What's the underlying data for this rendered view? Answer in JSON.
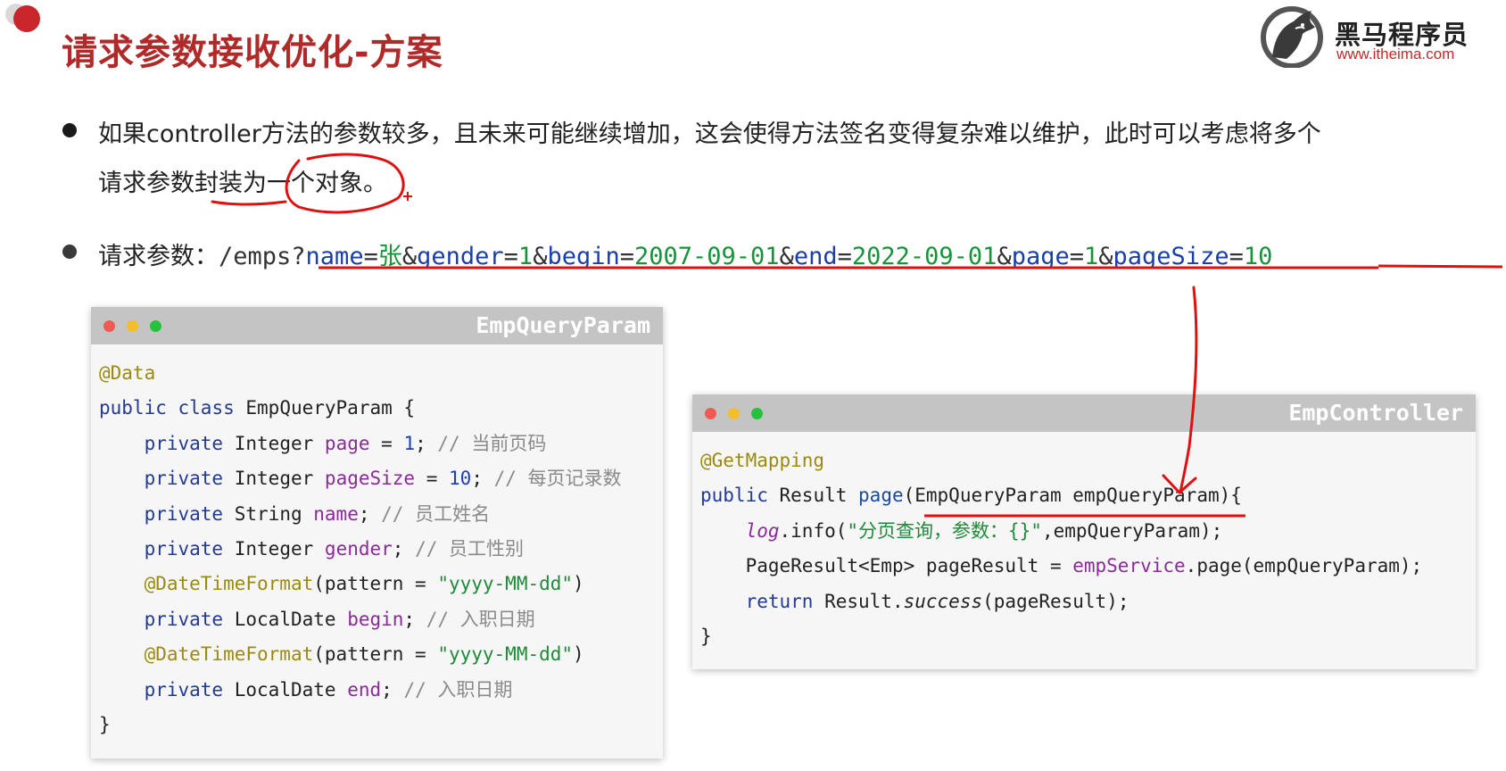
{
  "slide": {
    "title": "请求参数接收优化-方案",
    "logo": {
      "name": "黑马程序员",
      "url": "www.itheima.com"
    }
  },
  "bullets": {
    "first": {
      "line1": "如果controller方法的参数较多，且未来可能继续增加，这会使得方法签名变得复杂难以维护，此时可以考虑将多个",
      "line2": "请求参数封装为一个对象。"
    },
    "second": {
      "label": "请求参数：",
      "path": "/emps?",
      "params": [
        {
          "key": "name",
          "value": "张"
        },
        {
          "key": "gender",
          "value": "1"
        },
        {
          "key": "begin",
          "value": "2007-09-01"
        },
        {
          "key": "end",
          "value": "2022-09-01"
        },
        {
          "key": "page",
          "value": "1"
        },
        {
          "key": "pageSize",
          "value": "10"
        }
      ],
      "eq": "=",
      "amp": "&"
    }
  },
  "param_window": {
    "title": "EmpQueryParam",
    "code": {
      "l1_ann": "@Data",
      "l2_public": "public",
      "l2_class": "class",
      "l2_rest": "EmpQueryParam {",
      "private": "private",
      "l3_type": "Integer",
      "l3_field": "page",
      "l3_eq": " = ",
      "l3_num": "1",
      "l3_semi": ";",
      "l3_cmt": "// 当前页码",
      "l4_type": "Integer",
      "l4_field": "pageSize",
      "l4_eq": " = ",
      "l4_num": "10",
      "l4_semi": ";",
      "l4_cmt": "// 每页记录数",
      "l5_type": "String",
      "l5_field": "name",
      "l5_semi": ";",
      "l5_cmt": "// 员工姓名",
      "l6_type": "Integer",
      "l6_field": "gender",
      "l6_semi": ";",
      "l6_cmt": "// 员工性别",
      "l7_ann": "@DateTimeFormat",
      "l7_mid": "(pattern = ",
      "l7_str": "\"yyyy-MM-dd\"",
      "l7_end": ")",
      "l8_type": "LocalDate",
      "l8_field": "begin",
      "l8_semi": ";",
      "l8_cmt": "// 入职日期",
      "l9_ann": "@DateTimeFormat",
      "l9_mid": "(pattern = ",
      "l9_str": "\"yyyy-MM-dd\"",
      "l9_end": ")",
      "l10_type": "LocalDate",
      "l10_field": "end",
      "l10_semi": ";",
      "l10_cmt": "// 入职日期",
      "close": "}"
    }
  },
  "controller_window": {
    "title": "EmpController",
    "code": {
      "l1_ann": "@GetMapping",
      "l2_public": "public",
      "l2_type": "Result",
      "l2_meth": "page",
      "l2_args": "(EmpQueryParam empQueryParam){",
      "l3_log": "log",
      "l3_call": ".info(",
      "l3_str": "\"分页查询，参数：{}\"",
      "l3_end": ",empQueryParam);",
      "l4_pre": "PageResult<Emp> pageResult = ",
      "l4_svc": "empService",
      "l4_end": ".page(empQueryParam);",
      "l5_ret": "return",
      "l5_obj": "Result.",
      "l5_meth": "success",
      "l5_end": "(pageResult);",
      "close": "}"
    }
  },
  "colors": {
    "title": "#b02a2a",
    "annotation_pen": "#e01010",
    "code_keyword": "#233a95",
    "code_field": "#8b2a99",
    "code_string": "#1f8a3a",
    "code_annotation": "#9b8a10",
    "code_comment": "#8a8a8a",
    "query_key": "#1a3fa8",
    "query_value": "#17943a",
    "window_bar": "#c4c4c4",
    "window_bg": "#f6f6f6"
  },
  "icons": [
    "traffic-light-close",
    "traffic-light-minimize",
    "traffic-light-maximize",
    "horse-logo"
  ]
}
